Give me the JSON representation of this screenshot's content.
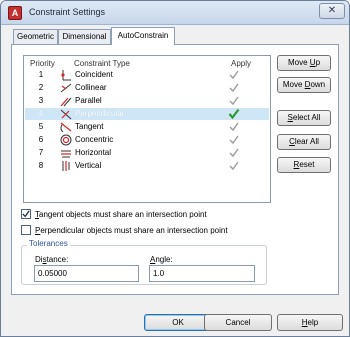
{
  "window": {
    "title": "Constraint Settings",
    "close_label": "✕"
  },
  "tabs": [
    {
      "label": "Geometric"
    },
    {
      "label": "Dimensional"
    },
    {
      "label": "AutoConstrain"
    }
  ],
  "table": {
    "headers": {
      "priority": "Priority",
      "type": "Constraint Type",
      "apply": "Apply"
    },
    "rows": [
      {
        "priority": "1",
        "type": "Coincident",
        "icon": "coincident-icon",
        "applied": true
      },
      {
        "priority": "2",
        "type": "Collinear",
        "icon": "collinear-icon",
        "applied": true
      },
      {
        "priority": "3",
        "type": "Parallel",
        "icon": "parallel-icon",
        "applied": true
      },
      {
        "priority": "4",
        "type": "Perpendicular",
        "icon": "perpendicular-icon",
        "applied": true
      },
      {
        "priority": "5",
        "type": "Tangent",
        "icon": "tangent-icon",
        "applied": true
      },
      {
        "priority": "6",
        "type": "Concentric",
        "icon": "concentric-icon",
        "applied": true
      },
      {
        "priority": "7",
        "type": "Horizontal",
        "icon": "horizontal-icon",
        "applied": true
      },
      {
        "priority": "8",
        "type": "Vertical",
        "icon": "vertical-icon",
        "applied": true
      }
    ],
    "selected_priority": "4"
  },
  "side_buttons": {
    "move_up": {
      "pre": "Move ",
      "key": "U",
      "post": "p"
    },
    "move_down": {
      "pre": "Move ",
      "key": "D",
      "post": "own"
    },
    "select_all": {
      "pre": "",
      "key": "S",
      "post": "elect All"
    },
    "clear_all": {
      "pre": "",
      "key": "C",
      "post": "lear All"
    },
    "reset": {
      "pre": "",
      "key": "R",
      "post": "eset"
    }
  },
  "options": {
    "tangent": {
      "pre": "",
      "key": "T",
      "post": "angent objects must share an intersection point",
      "checked": true
    },
    "perpendicular": {
      "pre": "",
      "key": "P",
      "post": "erpendicular objects must share an intersection point",
      "checked": false
    }
  },
  "tolerances": {
    "legend": "Tolerances",
    "distance_label_pre": "Di",
    "distance_label_key": "s",
    "distance_label_post": "tance:",
    "distance_value": "0.05000",
    "angle_label_pre": "",
    "angle_label_key": "A",
    "angle_label_post": "ngle:",
    "angle_value": "1.0"
  },
  "footer": {
    "ok": {
      "pre": "",
      "key": "",
      "post": "OK"
    },
    "cancel": {
      "pre": "Cancel",
      "key": "",
      "post": ""
    },
    "help": {
      "pre": "",
      "key": "H",
      "post": "elp"
    }
  },
  "colors": {
    "accent": "#2c55a3",
    "selection": "#cfe6f6",
    "check_active": "#2e9b2e",
    "check_inactive": "#9c9c9c"
  }
}
